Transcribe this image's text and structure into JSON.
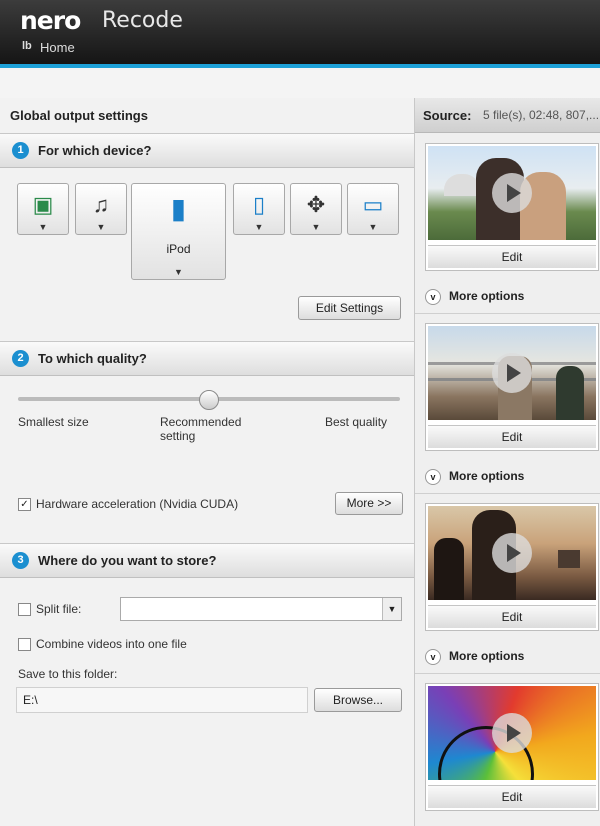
{
  "app": {
    "logo": "nero",
    "name": "Recode",
    "home_icon": "lb",
    "home_label": "Home"
  },
  "global_title": "Global output settings",
  "sections": [
    {
      "num": "1",
      "title": "For which device?"
    },
    {
      "num": "2",
      "title": "To which quality?"
    },
    {
      "num": "3",
      "title": "Where do you want to store?"
    }
  ],
  "devices": [
    {
      "icon": "media-player-icon",
      "glyph": "▣"
    },
    {
      "icon": "music-note-icon",
      "glyph": "♫"
    },
    {
      "icon": "ipod-icon",
      "glyph": "▮",
      "label": "iPod",
      "selected": true
    },
    {
      "icon": "phone-icon",
      "glyph": "▯"
    },
    {
      "icon": "gamepad-icon",
      "glyph": "✥"
    },
    {
      "icon": "handheld-icon",
      "glyph": "▭"
    }
  ],
  "edit_settings": "Edit Settings",
  "quality": {
    "level": 0.5,
    "labels": [
      "Smallest size",
      "Recommended setting",
      "Best quality"
    ],
    "hw_accel": "Hardware acceleration (Nvidia CUDA)",
    "hw_accel_checked": true,
    "more": "More >>"
  },
  "store": {
    "split_label": "Split file:",
    "split_value": "",
    "combine_label": "Combine videos into one file",
    "folder_label": "Save to this folder:",
    "folder_value": "E:\\",
    "browse": "Browse..."
  },
  "source": {
    "label": "Source:",
    "info": "5 file(s), 02:48, 807,..."
  },
  "clips": [
    {
      "edit": "Edit",
      "more": "More options",
      "scene": "couple"
    },
    {
      "edit": "Edit",
      "more": "More options",
      "scene": "bridge"
    },
    {
      "edit": "Edit",
      "more": "More options",
      "scene": "sunset"
    },
    {
      "edit": "Edit",
      "more": "",
      "scene": "colors"
    }
  ],
  "colors": {
    "accent": "#1da1d8",
    "step_badge": "#1b8fd0"
  }
}
